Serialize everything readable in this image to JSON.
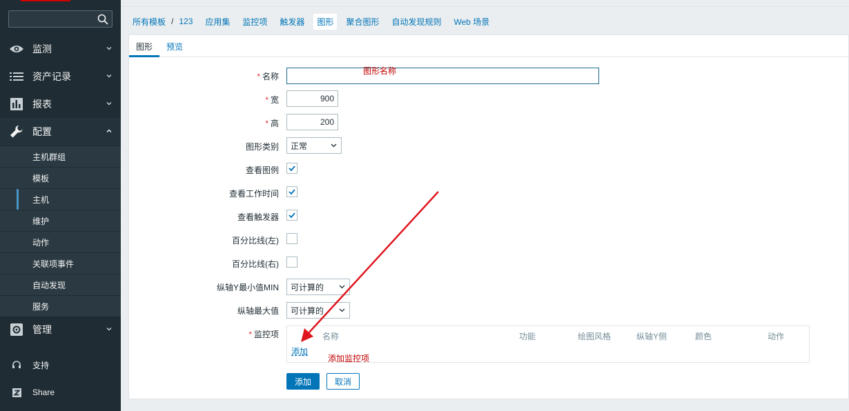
{
  "sidebar": {
    "search_placeholder": "",
    "menu": [
      {
        "label": "监测",
        "icon": "eye-icon"
      },
      {
        "label": "资产记录",
        "icon": "list-icon"
      },
      {
        "label": "报表",
        "icon": "bar-chart-icon"
      },
      {
        "label": "配置",
        "icon": "wrench-icon"
      }
    ],
    "config_submenu": [
      "主机群组",
      "模板",
      "主机",
      "维护",
      "动作",
      "关联项事件",
      "自动发现",
      "服务"
    ],
    "admin": {
      "label": "管理",
      "icon": "gear-icon"
    },
    "support": {
      "label": "支持",
      "icon": "headset-icon"
    },
    "share": {
      "label": "Share",
      "icon": "zabbix-share-icon"
    }
  },
  "breadcrumb": {
    "all_templates": "所有模板",
    "separator": "/",
    "template": "123",
    "tabs": [
      "应用集",
      "监控项",
      "触发器",
      "图形",
      "聚合图形",
      "自动发现规则",
      "Web 场景"
    ],
    "active_tab": "图形"
  },
  "form_tabs": {
    "graph": "图形",
    "preview": "预览"
  },
  "form": {
    "name_label": "名称",
    "name_value": "",
    "width_label": "宽",
    "width_value": "900",
    "height_label": "高",
    "height_value": "200",
    "graph_type_label": "图形类别",
    "graph_type_value": "正常",
    "show_legend_label": "查看图例",
    "show_legend": true,
    "show_worktime_label": "查看工作时间",
    "show_worktime": true,
    "show_triggers_label": "查看触发器",
    "show_triggers": true,
    "percentile_left_label": "百分比线(左)",
    "percentile_left": false,
    "percentile_right_label": "百分比线(右)",
    "percentile_right": false,
    "ymin_label": "纵轴Y最小值MIN",
    "ymin_value": "可计算的",
    "ymax_label": "纵轴最大值",
    "ymax_value": "可计算的",
    "items_label": "监控项",
    "items_headers": [
      "名称",
      "功能",
      "绘图风格",
      "纵轴Y侧",
      "颜色",
      "动作"
    ],
    "items_add_link": "添加",
    "submit_label": "添加",
    "cancel_label": "取消"
  },
  "annotations": {
    "graph_name_hint": "图形名称",
    "add_item_hint": "添加监控项"
  },
  "colors": {
    "accent": "#0275b8",
    "sidebar": "#1f2c33",
    "annotation": "#c00000",
    "arrow": "#e0161e"
  }
}
